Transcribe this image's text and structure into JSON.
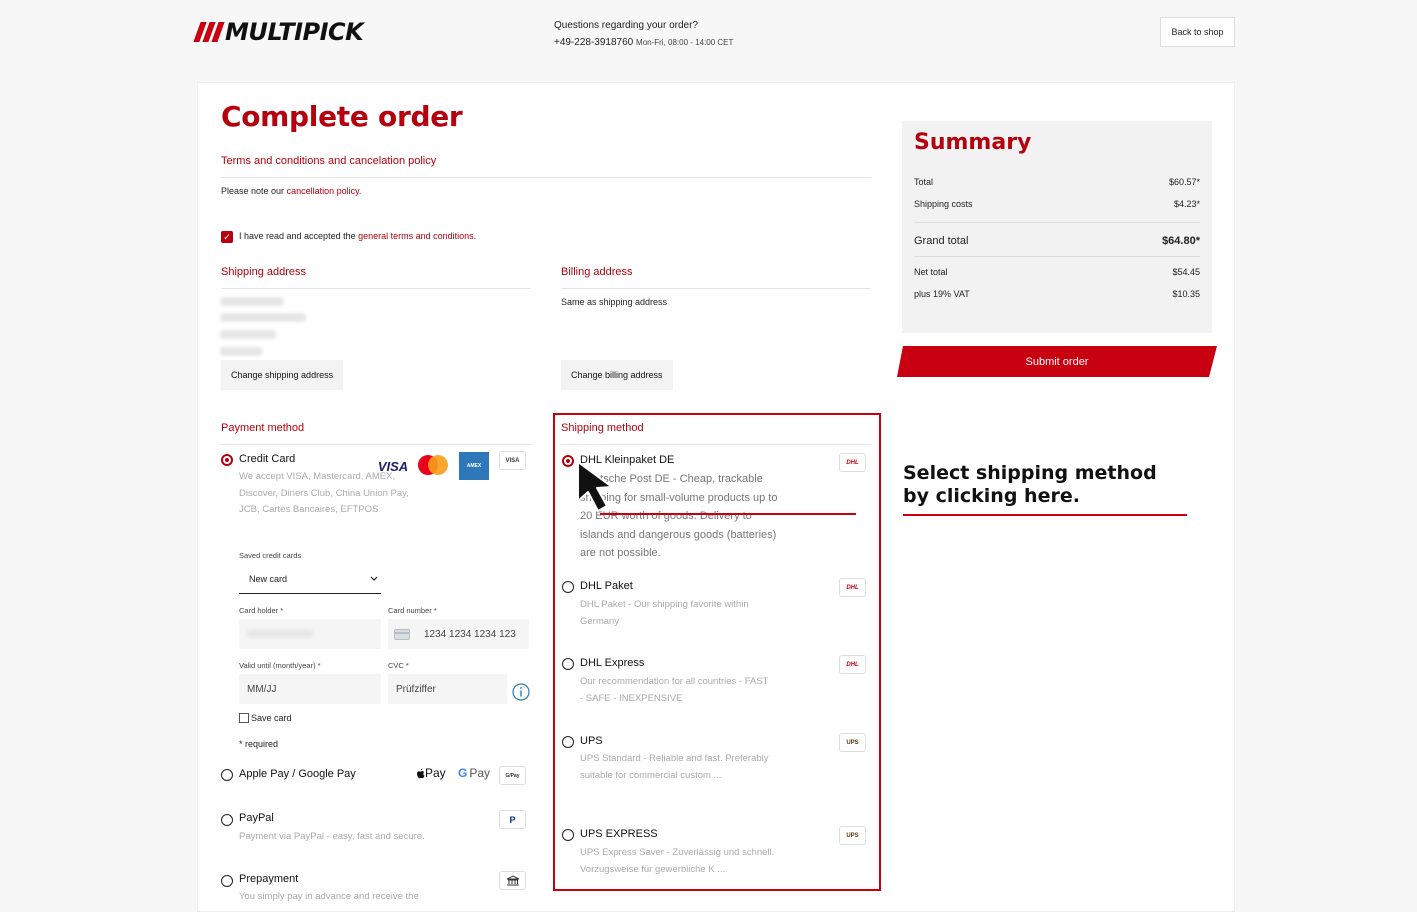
{
  "header": {
    "logo_text": "MULTIPICK",
    "contact_question": "Questions regarding your order?",
    "phone": "+49-228-3918760",
    "hours": "Mon-Fri, 08:00 - 14:00 CET",
    "back_label": "Back to shop"
  },
  "page_title": "Complete order",
  "terms": {
    "heading": "Terms and conditions and cancelation policy",
    "note_prefix": "Please note our",
    "note_link": "cancellation policy.",
    "accept_prefix": "I have read and accepted the",
    "accept_link": "general terms and conditions.",
    "accepted": true
  },
  "shipping_address": {
    "heading": "Shipping address",
    "change_label": "Change shipping address"
  },
  "billing_address": {
    "heading": "Billing address",
    "text": "Same as shipping address",
    "change_label": "Change billing address"
  },
  "payment": {
    "heading": "Payment method",
    "credit_card": {
      "label": "Credit Card",
      "selected": true,
      "desc": "We accept VISA, Mastercard, AMEX, Discover, Diners Club, China Union Pay, JCB, Cartes Bancaires, EFTPOS",
      "saved_label": "Saved credit cards",
      "saved_value": "New card",
      "holder_label": "Card holder *",
      "number_label": "Card number *",
      "number_placeholder": "1234 1234 1234 123",
      "valid_label": "Valid until (month/year) *",
      "valid_placeholder": "MM/JJ",
      "cvc_label": "CVC *",
      "cvc_placeholder": "Prüfziffer",
      "save_card": "Save card",
      "required": "* required"
    },
    "wallet": {
      "label": "Apple Pay / Google Pay",
      "apple": "Pay",
      "google": "Pay"
    },
    "paypal": {
      "label": "PayPal",
      "desc": "Payment via PayPal - easy, fast and secure."
    },
    "prepayment": {
      "label": "Prepayment",
      "desc": "You simply pay in advance and receive the"
    }
  },
  "shipping_method": {
    "heading": "Shipping method",
    "options": [
      {
        "label": "DHL Kleinpaket DE",
        "selected": true,
        "desc": "Deutsche Post DE - Cheap, trackable shipping for small-volume products up to 20 EUR worth of goods. Delivery to islands and dangerous goods (batteries) are not possible.",
        "logo": "DHL"
      },
      {
        "label": "DHL Paket",
        "selected": false,
        "desc": "DHL Paket - Our shipping favorite within Germany",
        "logo": "DHL"
      },
      {
        "label": "DHL Express",
        "selected": false,
        "desc": "Our recommendation for all countries - FAST - SAFE - INEXPENSIVE",
        "logo": "DHL"
      },
      {
        "label": "UPS",
        "selected": false,
        "desc": "UPS Standard - Reliable and fast. Preferably suitable for commercial custom ...",
        "logo": "UPS"
      },
      {
        "label": "UPS EXPRESS",
        "selected": false,
        "desc": "UPS Express Saver - Zuverlässig und schnell. Vorzugsweise für gewerbliche K ...",
        "logo": "UPS"
      }
    ]
  },
  "summary": {
    "heading": "Summary",
    "total_label": "Total",
    "total": "$60.57*",
    "shipping_label": "Shipping costs",
    "shipping": "$4.23*",
    "grand_label": "Grand total",
    "grand": "$64.80*",
    "net_label": "Net total",
    "net": "$54.45",
    "vat_label": "plus 19% VAT",
    "vat": "$10.35",
    "submit_label": "Submit order"
  },
  "callout": {
    "line1": "Select shipping method",
    "line2": "by clicking here."
  },
  "colors": {
    "accent": "#b5000d",
    "brand_red": "#c8000f"
  }
}
